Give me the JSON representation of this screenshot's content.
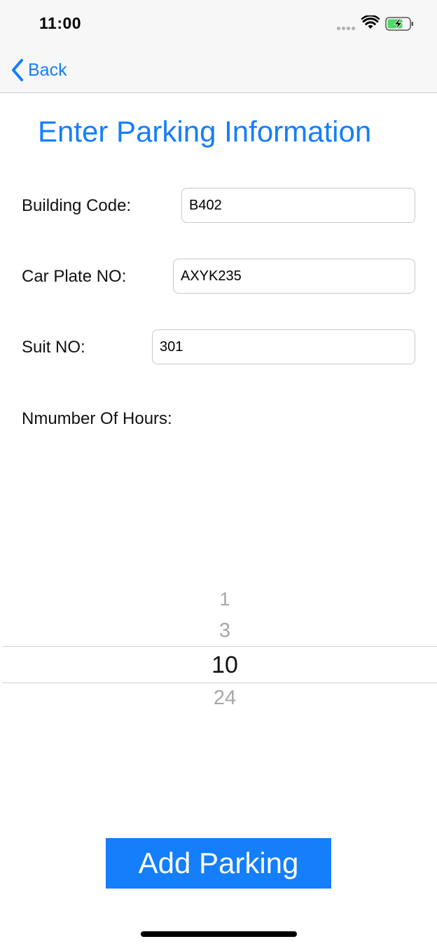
{
  "status_bar": {
    "time": "11:00",
    "icons": [
      "cellular-dots-icon",
      "wifi-icon",
      "battery-charging-icon"
    ],
    "battery_color": "#4cd964"
  },
  "nav": {
    "back_label": "Back",
    "back_icon": "chevron-left-icon"
  },
  "page": {
    "title": "Enter Parking Information"
  },
  "form": {
    "building_code": {
      "label": "Building Code:",
      "value": "B402"
    },
    "car_plate": {
      "label": "Car Plate NO:",
      "value": "AXYK235"
    },
    "suit_no": {
      "label": "Suit NO:",
      "value": "301"
    },
    "hours": {
      "label": "Nmumber Of Hours:",
      "options": [
        "1",
        "3",
        "10",
        "24"
      ],
      "selected": "10"
    }
  },
  "actions": {
    "add_parking_label": "Add Parking"
  },
  "colors": {
    "accent": "#147efb",
    "bar_background": "#f7f7f7"
  }
}
